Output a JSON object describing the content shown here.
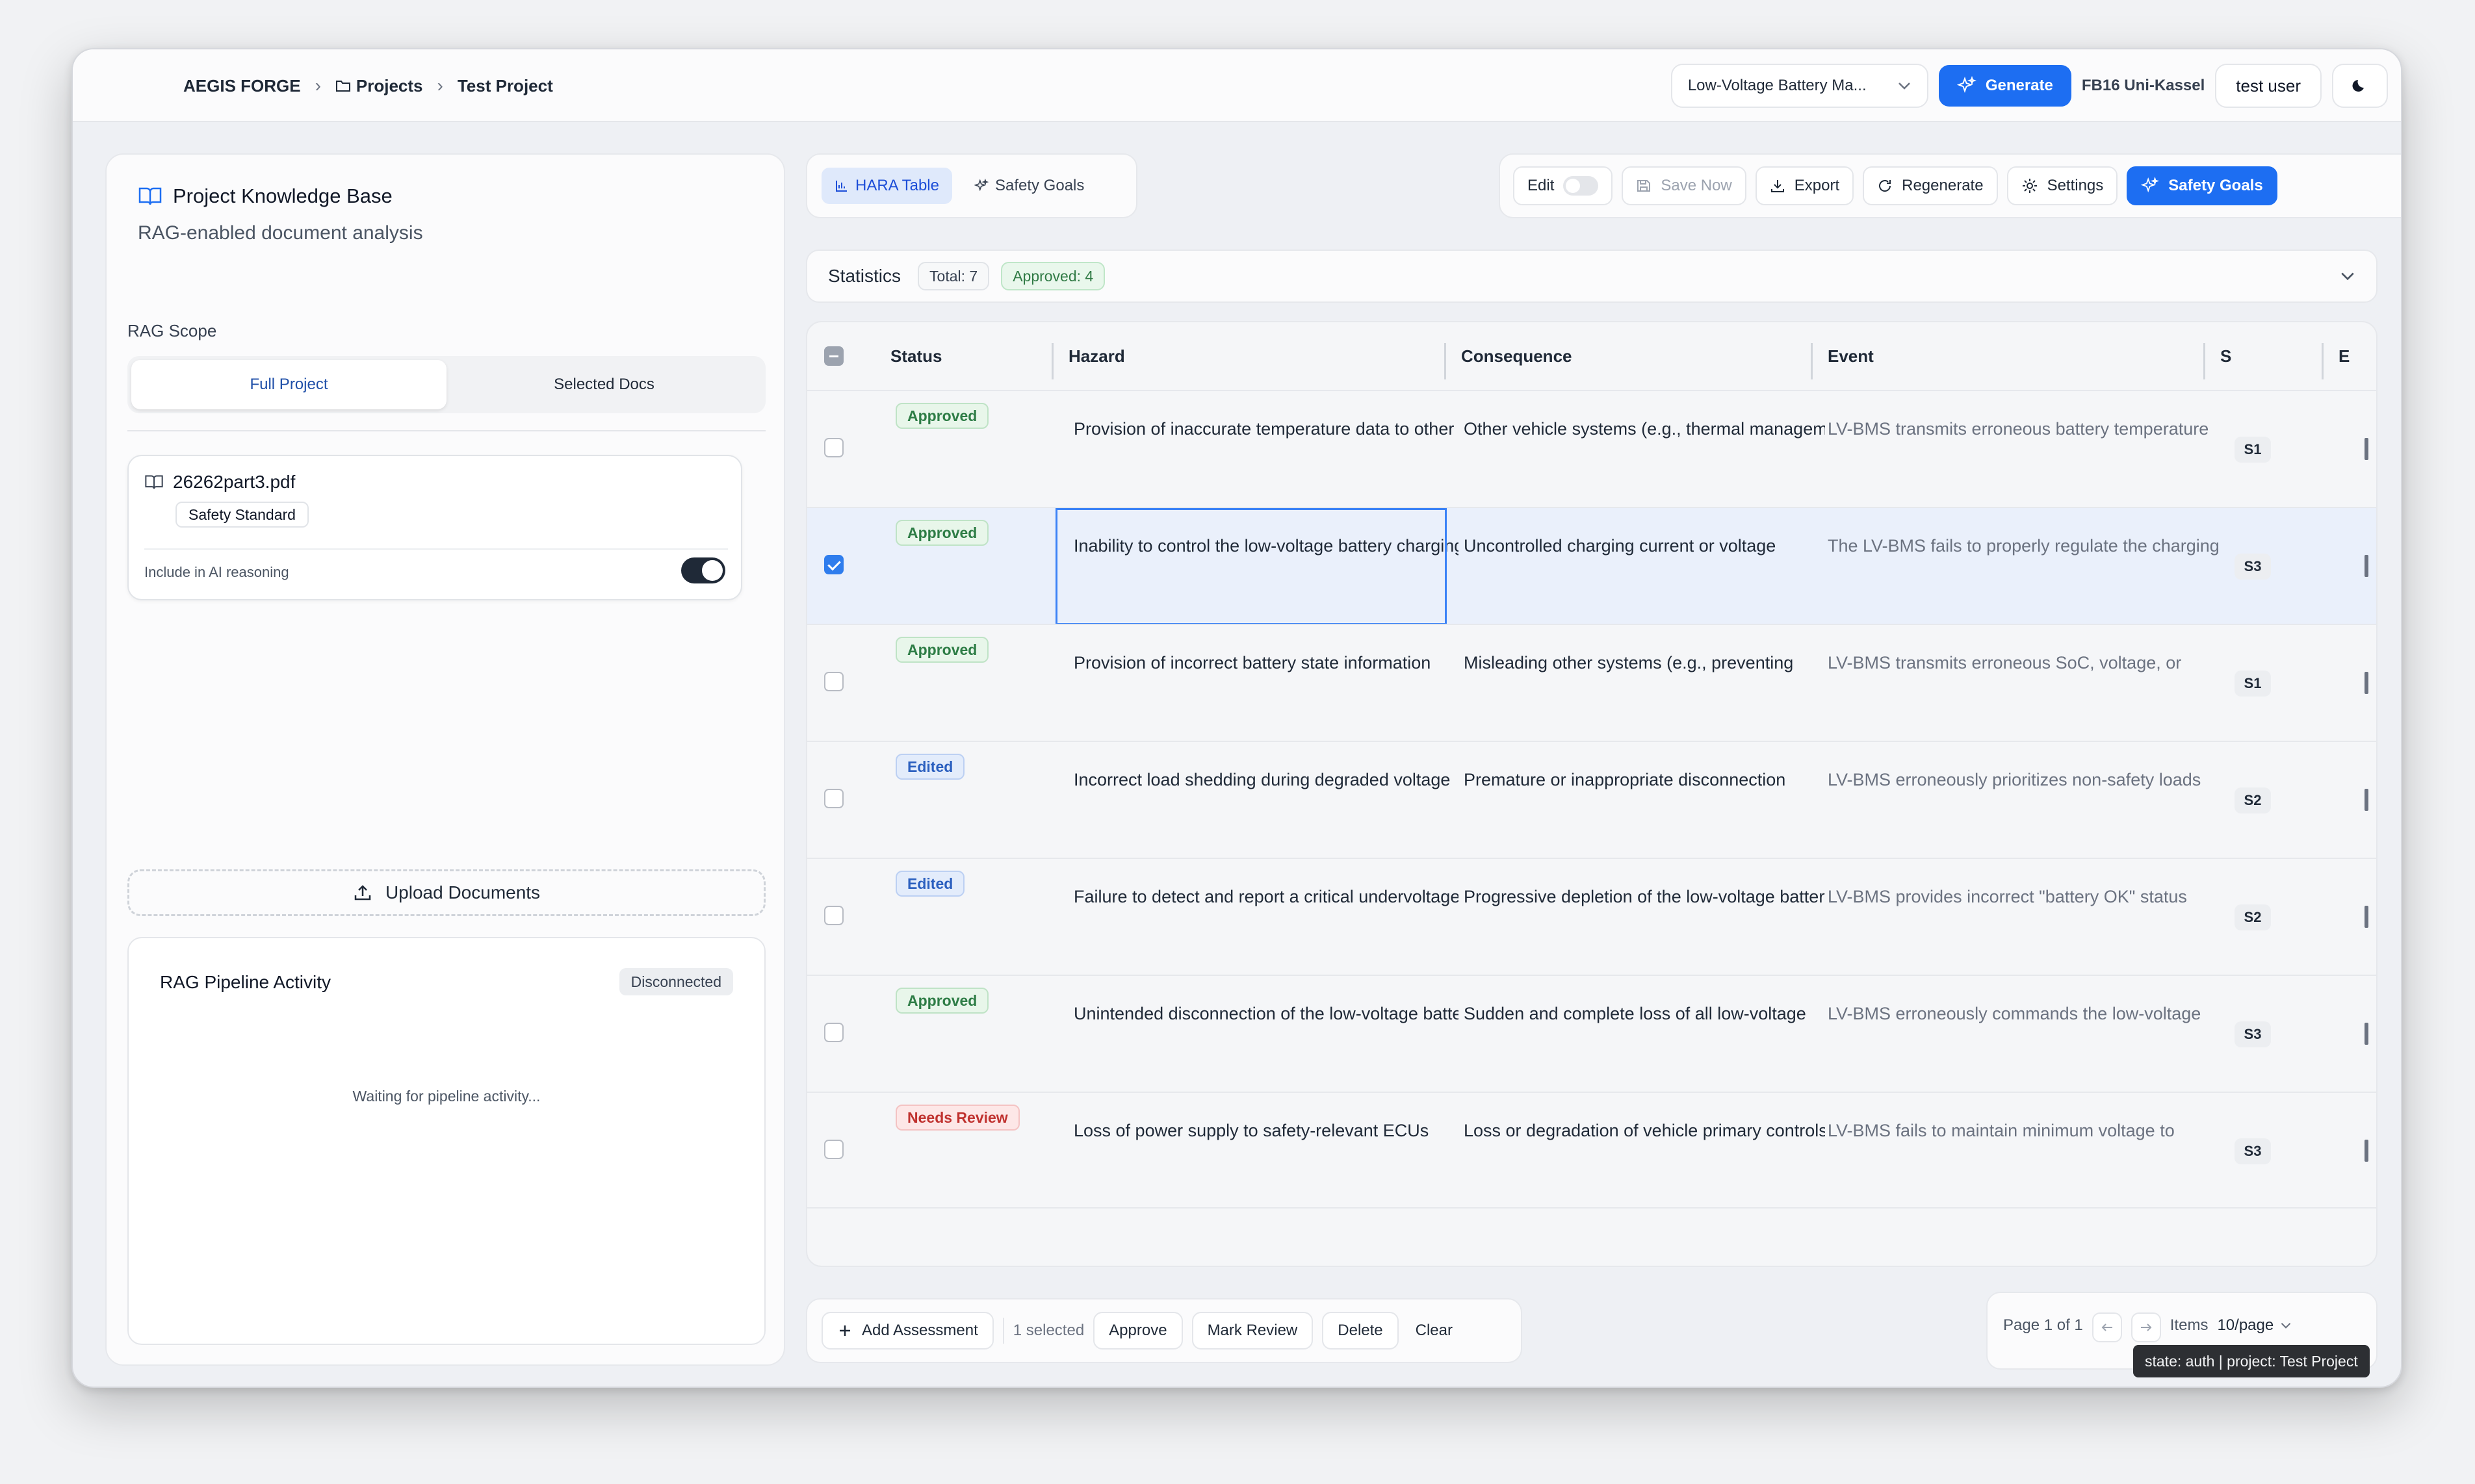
{
  "header": {
    "brand": "AEGIS FORGE",
    "crumb_projects": "Projects",
    "crumb_project": "Test Project",
    "project_select": "Low-Voltage Battery Ma...",
    "generate_label": "Generate",
    "org": "FB16 Uni-Kassel",
    "user": "test user"
  },
  "knowledge": {
    "title": "Project Knowledge Base",
    "subtitle": "RAG-enabled document analysis",
    "scope_label": "RAG Scope",
    "scope_full": "Full Project",
    "scope_selected": "Selected Docs",
    "doc_name": "26262part3.pdf",
    "doc_badge": "Safety Standard",
    "doc_include": "Include in AI reasoning",
    "upload_label": "Upload Documents",
    "pipeline_title": "RAG Pipeline Activity",
    "pipeline_status": "Disconnected",
    "pipeline_wait": "Waiting for pipeline activity..."
  },
  "tabs": {
    "hara": "HARA Table",
    "goals": "Safety Goals"
  },
  "toolbar": {
    "edit": "Edit",
    "save": "Save Now",
    "export": "Export",
    "regenerate": "Regenerate",
    "settings": "Settings",
    "safety_goals": "Safety Goals"
  },
  "stats": {
    "label": "Statistics",
    "total": "Total: 7",
    "approved": "Approved: 4"
  },
  "columns": {
    "status": "Status",
    "hazard": "Hazard",
    "consequence": "Consequence",
    "event": "Event",
    "s": "S",
    "e": "E"
  },
  "rows": [
    {
      "status": "Approved",
      "hazard": "Provision of inaccurate temperature data to other vehicle systems",
      "consequence": "Other vehicle systems (e.g., thermal management",
      "event": "LV-BMS transmits erroneous battery temperature",
      "s": "S1"
    },
    {
      "status": "Approved",
      "hazard": "Inability to control the low-voltage battery charging",
      "consequence": "Uncontrolled charging current or voltage",
      "event": "The LV-BMS fails to properly regulate the charging",
      "s": "S3"
    },
    {
      "status": "Approved",
      "hazard": "Provision of incorrect battery state information",
      "consequence": "Misleading other systems (e.g., preventing",
      "event": "LV-BMS transmits erroneous SoC, voltage, or",
      "s": "S1"
    },
    {
      "status": "Edited",
      "hazard": "Incorrect load shedding during degraded voltage",
      "consequence": "Premature or inappropriate disconnection",
      "event": "LV-BMS erroneously prioritizes non-safety loads",
      "s": "S2"
    },
    {
      "status": "Edited",
      "hazard": "Failure to detect and report a critical undervoltage",
      "consequence": "Progressive depletion of the low-voltage battery",
      "event": "LV-BMS provides incorrect \"battery OK\" status",
      "s": "S2"
    },
    {
      "status": "Approved",
      "hazard": "Unintended disconnection of the low-voltage battery",
      "consequence": "Sudden and complete loss of all low-voltage",
      "event": "LV-BMS erroneously commands the low-voltage",
      "s": "S3"
    },
    {
      "status": "Needs Review",
      "hazard": "Loss of power supply to safety-relevant ECUs",
      "consequence": "Loss or degradation of vehicle primary controls",
      "event": "LV-BMS fails to maintain minimum voltage to",
      "s": "S3"
    }
  ],
  "bottom": {
    "add": "Add Assessment",
    "selected": "1 selected",
    "approve": "Approve",
    "mark_review": "Mark Review",
    "delete": "Delete",
    "clear": "Clear"
  },
  "pager": {
    "page": "Page 1 of 1",
    "items_label": "Items",
    "per_page": "10/page"
  },
  "tooltip": "state: auth | project: Test Project",
  "colors": {
    "primary": "#1d6ef2",
    "approved": "#2e7d46",
    "edited": "#2a5fbf",
    "review": "#c0322f"
  }
}
